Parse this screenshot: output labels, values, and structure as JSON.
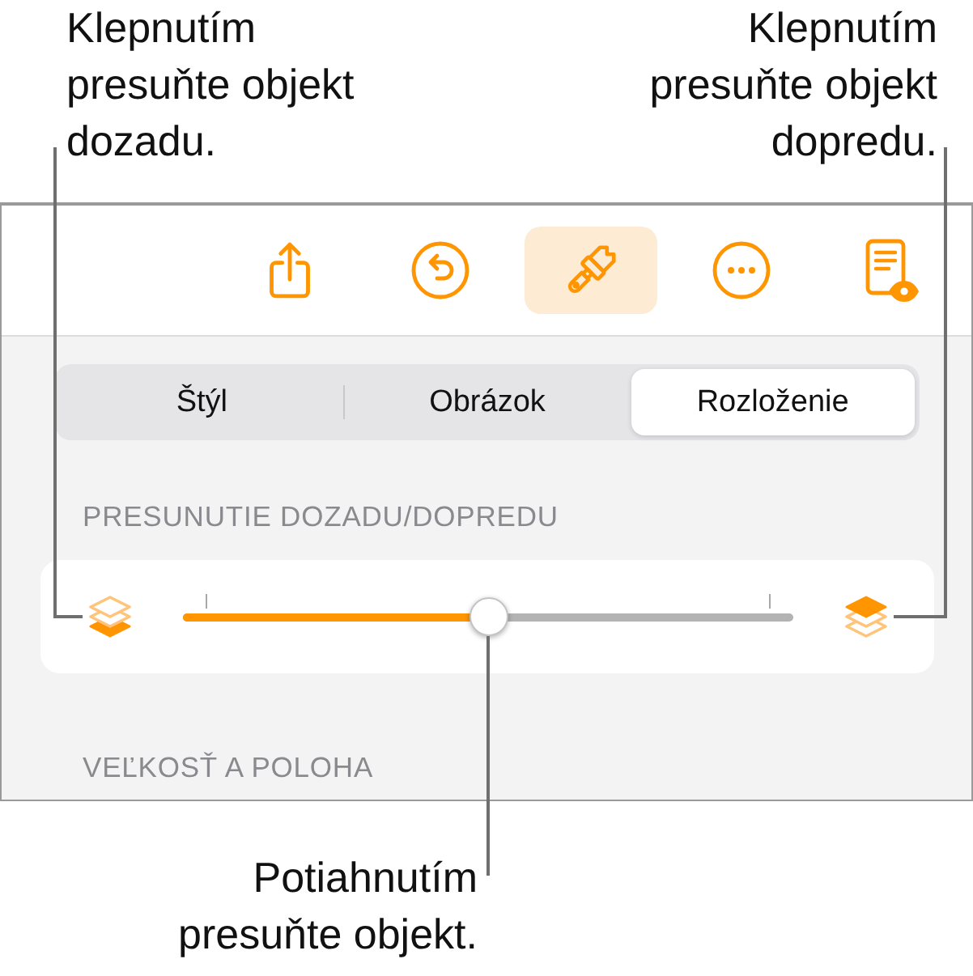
{
  "callouts": {
    "send_backward": "Klepnutím presuňte objekt dozadu.",
    "bring_forward": "Klepnutím presuňte objekt dopredu.",
    "drag": "Potiahnutím presuňte objekt."
  },
  "toolbar": {
    "buttons": [
      {
        "kind": "share",
        "selected": false
      },
      {
        "kind": "undo",
        "selected": false
      },
      {
        "kind": "format",
        "selected": true
      },
      {
        "kind": "more",
        "selected": false
      },
      {
        "kind": "reader",
        "selected": false
      }
    ]
  },
  "tabs": [
    {
      "label": "Štýl",
      "selected": false
    },
    {
      "label": "Obrázok",
      "selected": false
    },
    {
      "label": "Rozloženie",
      "selected": true
    }
  ],
  "arrange": {
    "header": "PRESUNUTIE DOZADU/DOPREDU",
    "slider": {
      "level": 0.5
    }
  },
  "size_position": {
    "header": "VEĽKOSŤ A POLOHA"
  }
}
